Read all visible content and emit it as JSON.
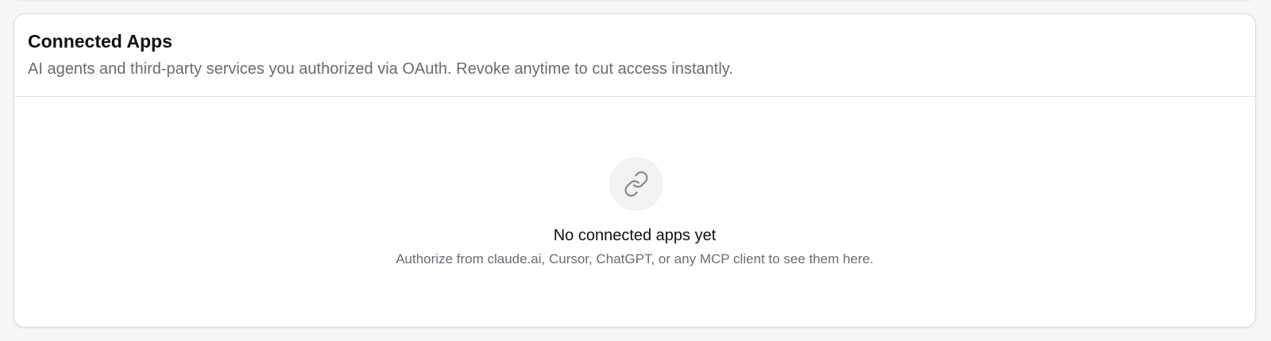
{
  "connected_apps": {
    "title": "Connected Apps",
    "subtitle": "AI agents and third-party services you authorized via OAuth. Revoke anytime to cut access instantly.",
    "empty_state": {
      "icon": "link-icon",
      "title": "No connected apps yet",
      "description": "Authorize from claude.ai, Cursor, ChatGPT, or any MCP client to see them here."
    }
  },
  "colors": {
    "background": "#f7f7f7",
    "card": "#ffffff",
    "title": "#111111",
    "muted_text": "#6b6b72",
    "icon_circle": "#f2f2f2",
    "icon_stroke": "#8a8a8f"
  }
}
